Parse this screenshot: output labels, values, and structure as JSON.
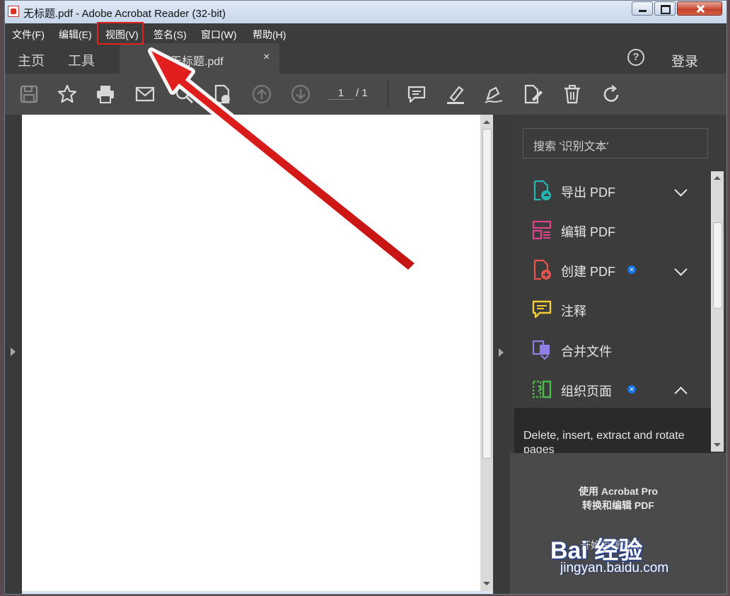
{
  "window": {
    "title": "无标题.pdf - Adobe Acrobat Reader (32-bit)"
  },
  "menu": {
    "items": [
      "文件(F)",
      "编辑(E)",
      "视图(V)",
      "签名(S)",
      "窗口(W)",
      "帮助(H)"
    ],
    "highlighted": "视图(V)"
  },
  "tabs": {
    "home": "主页",
    "tools": "工具",
    "document": "无标题.pdf",
    "close": "×",
    "help": "?",
    "login": "登录"
  },
  "toolbar": {
    "icons": [
      "save-icon",
      "bookmark-star-icon",
      "print-icon",
      "email-icon",
      "search-zoom-icon",
      "share-file-icon",
      "page-up-icon",
      "page-down-icon",
      "comment-icon",
      "highlight-icon",
      "sign-icon",
      "fill-sign-icon",
      "delete-icon",
      "rotate-icon"
    ],
    "page_current": "1",
    "page_total": "/ 1"
  },
  "right_panel": {
    "search_placeholder": "搜索 '识别文本'",
    "tools": [
      {
        "label": "导出 PDF",
        "icon": "export-pdf-icon",
        "color": "#26b5b0",
        "expand": "down"
      },
      {
        "label": "编辑 PDF",
        "icon": "edit-pdf-icon",
        "color": "#e0438b"
      },
      {
        "label": "创建 PDF",
        "icon": "create-pdf-icon",
        "color": "#e8554e",
        "badge": true,
        "expand": "down"
      },
      {
        "label": "注释",
        "icon": "comment-tool-icon",
        "color": "#f4cd32"
      },
      {
        "label": "合并文件",
        "icon": "combine-files-icon",
        "color": "#8e7fe6"
      },
      {
        "label": "组织页面",
        "icon": "organize-pages-icon",
        "color": "#4cbb47",
        "badge": true,
        "expand": "up"
      }
    ],
    "tool_description": "Delete, insert, extract and rotate pages",
    "promo_line1": "使用 Acrobat Pro",
    "promo_line2": "转换和编辑 PDF",
    "promo_button": "开始免费试用"
  },
  "watermark": {
    "main": "Bai 经验",
    "sub": "jingyan.baidu.com"
  },
  "colors": {
    "annotation": "#e4201f",
    "panel_dark": "#3c3c3c",
    "toolbar": "#4a4a4a"
  }
}
